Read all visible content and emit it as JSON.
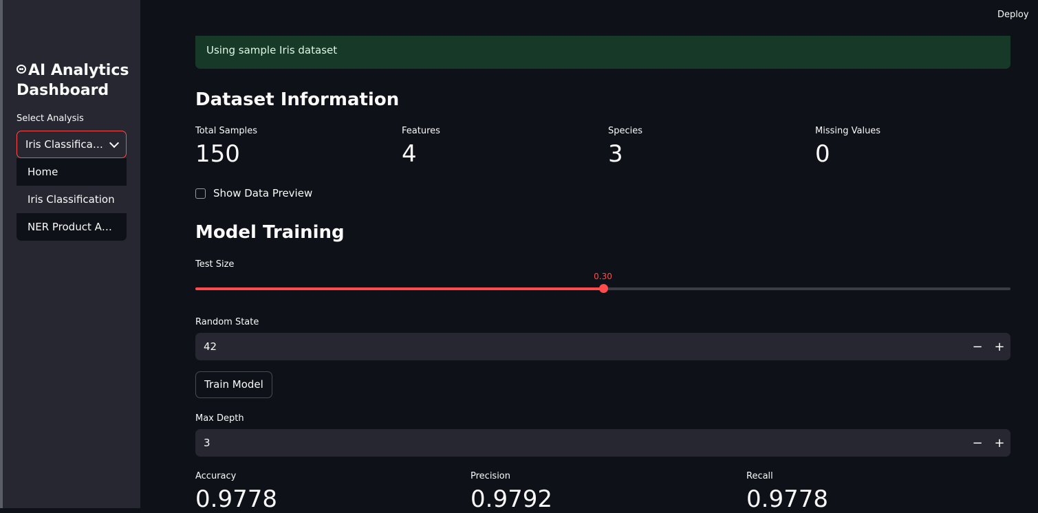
{
  "sidebar": {
    "title": "AI Analytics Dashboard",
    "select_label": "Select Analysis",
    "selected_value": "Iris Classification",
    "options": [
      "Home",
      "Iris Classification",
      "NER Product Analysis"
    ]
  },
  "header": {
    "deploy_label": "Deploy"
  },
  "alert": {
    "text": "Using sample Iris dataset"
  },
  "dataset_info": {
    "heading": "Dataset Information",
    "metrics": [
      {
        "label": "Total Samples",
        "value": "150"
      },
      {
        "label": "Features",
        "value": "4"
      },
      {
        "label": "Species",
        "value": "3"
      },
      {
        "label": "Missing Values",
        "value": "0"
      }
    ],
    "preview_checkbox_label": "Show Data Preview",
    "preview_checked": false
  },
  "model_training": {
    "heading": "Model Training",
    "test_size": {
      "label": "Test Size",
      "value_text": "0.30",
      "fraction": 0.5
    },
    "random_state": {
      "label": "Random State",
      "value": "42"
    },
    "train_button_label": "Train Model",
    "max_depth": {
      "label": "Max Depth",
      "value": "3"
    },
    "stepper_minus": "−",
    "stepper_plus": "+"
  },
  "results": {
    "metrics": [
      {
        "label": "Accuracy",
        "value": "0.9778"
      },
      {
        "label": "Precision",
        "value": "0.9792"
      },
      {
        "label": "Recall",
        "value": "0.9778"
      }
    ]
  },
  "colors": {
    "accent": "#ff4b4b",
    "background": "#0e1117",
    "sidebar": "#262730",
    "success_bg": "#173928"
  }
}
